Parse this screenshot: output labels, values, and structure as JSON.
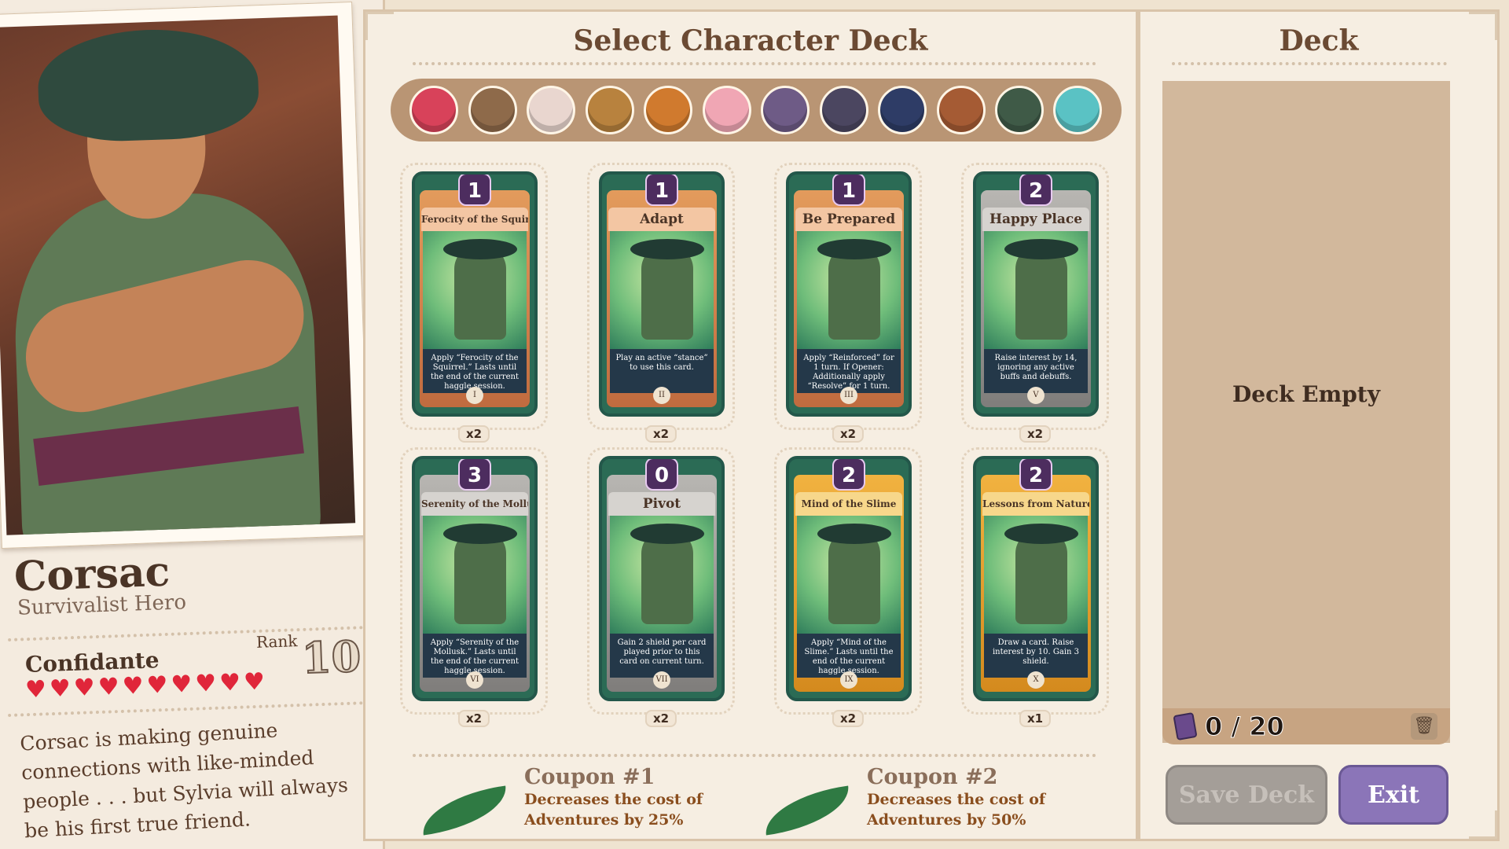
{
  "hero": {
    "name": "Corsac",
    "title": "Survivalist Hero",
    "relationship": "Confidante",
    "rank_label": "Rank",
    "rank_value": "10",
    "hearts": 10,
    "bio": "Corsac is making genuine connections with like-minded people . . . but Sylvia will always be his first true friend."
  },
  "center": {
    "title": "Select Character Deck",
    "characters": [
      {
        "name": "red-hair-character-icon",
        "color": "#d8425a"
      },
      {
        "name": "owl-character-icon",
        "color": "#8e6a4a"
      },
      {
        "name": "horned-character-icon",
        "color": "#e9d6cf"
      },
      {
        "name": "bear-character-icon",
        "color": "#b8823e"
      },
      {
        "name": "lion-character-icon",
        "color": "#d07a2e"
      },
      {
        "name": "pink-creature-character-icon",
        "color": "#f0a6b4"
      },
      {
        "name": "purple-witch-character-icon",
        "color": "#6e5b86"
      },
      {
        "name": "cat-character-icon",
        "color": "#4b4660"
      },
      {
        "name": "dark-hair-character-icon",
        "color": "#2e3c66"
      },
      {
        "name": "fox-character-icon",
        "color": "#a55b34"
      },
      {
        "name": "corsac-character-icon",
        "color": "#3f5a47"
      },
      {
        "name": "teal-hair-character-icon",
        "color": "#5ac2c4"
      }
    ],
    "cards": [
      {
        "cost": "1",
        "name": "Ferocity of the Squirrel",
        "desc": "Apply “Ferocity of the Squirrel.” Lasts until the end of the current haggle session.",
        "numeral": "I",
        "count": "x2",
        "style": "orange"
      },
      {
        "cost": "1",
        "name": "Adapt",
        "desc": "Play an active “stance” to use this card.",
        "numeral": "II",
        "count": "x2",
        "style": "orange"
      },
      {
        "cost": "1",
        "name": "Be Prepared",
        "desc": "Apply “Reinforced” for 1 turn. If Opener: Additionally apply “Resolve” for 1 turn.",
        "numeral": "III",
        "count": "x2",
        "style": "orange"
      },
      {
        "cost": "2",
        "name": "Happy Place",
        "desc": "Raise interest by 14, ignoring any active buffs and debuffs.",
        "numeral": "V",
        "count": "x2",
        "style": "grey"
      },
      {
        "cost": "3",
        "name": "Serenity of the Mollusk",
        "desc": "Apply “Serenity of the Mollusk.” Lasts until the end of the current haggle session.",
        "numeral": "VI",
        "count": "x2",
        "style": "grey"
      },
      {
        "cost": "0",
        "name": "Pivot",
        "desc": "Gain 2 shield per card played prior to this card on current turn.",
        "numeral": "VII",
        "count": "x2",
        "style": "grey"
      },
      {
        "cost": "2",
        "name": "Mind of the Slime",
        "desc": "Apply “Mind of the Slime.” Lasts until the end of the current haggle session.",
        "numeral": "IX",
        "count": "x2",
        "style": "gold"
      },
      {
        "cost": "2",
        "name": "Lessons from Nature",
        "desc": "Draw a card. Raise interest by 10. Gain 3 shield.",
        "numeral": "X",
        "count": "x1",
        "style": "gold"
      }
    ],
    "coupons": [
      {
        "title": "Coupon #1",
        "desc_line1": "Decreases the cost of",
        "desc_line2": "Adventures by 25%"
      },
      {
        "title": "Coupon #2",
        "desc_line1": "Decreases the cost of",
        "desc_line2": "Adventures by 50%"
      }
    ]
  },
  "deck": {
    "title": "Deck",
    "empty_text": "Deck Empty",
    "count": "0 / 20",
    "save_label": "Save Deck",
    "exit_label": "Exit"
  }
}
